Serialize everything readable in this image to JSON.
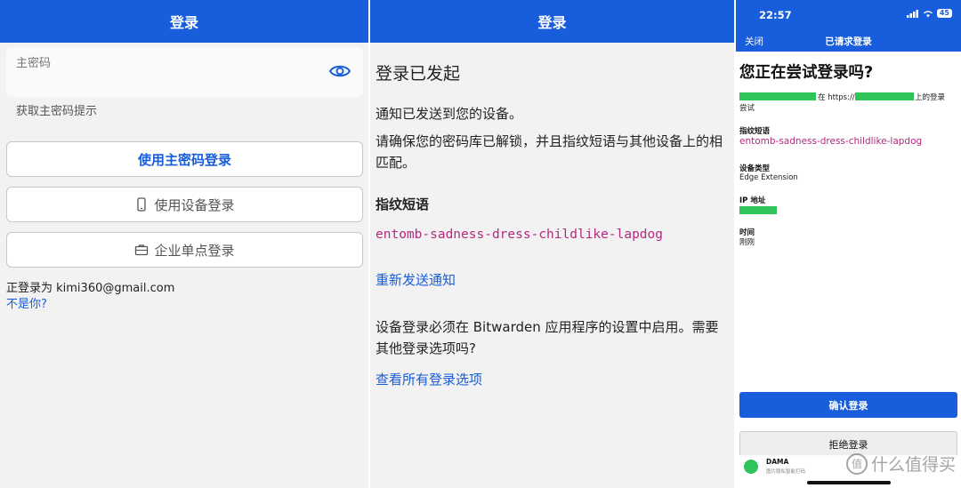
{
  "panel1": {
    "header_title": "登录",
    "master_password_label": "主密码",
    "get_hint_link": "获取主密码提示",
    "login_master_password_button": "使用主密码登录",
    "login_device_button": "使用设备登录",
    "enterprise_sso_button": "企业单点登录",
    "logged_in_as": "正登录为 kimi360@gmail.com",
    "not_you_link": "不是你?"
  },
  "panel2": {
    "header_title": "登录",
    "title": "登录已发起",
    "notification_sent": "通知已发送到您的设备。",
    "instructions": "请确保您的密码库已解锁，并且指纹短语与其他设备上的相匹配。",
    "fingerprint_heading": "指纹短语",
    "fingerprint_phrase": "entomb-sadness-dress-childlike-lapdog",
    "resend_link": "重新发送通知",
    "requirement_text": "设备登录必须在 Bitwarden 应用程序的设置中启用。需要其他登录选项吗?",
    "view_all_link": "查看所有登录选项"
  },
  "panel3": {
    "time": "22:57",
    "battery": "45",
    "close_link": "关闭",
    "nav_title": "已请求登录",
    "question_title": "您正在尝试登录吗?",
    "attempt_mid": "在 https://",
    "attempt_end": "上的登录",
    "attempt_line2": "尝试",
    "fingerprint_label": "指纹短语",
    "fingerprint_phrase": "entomb-sadness-dress-childlike-lapdog",
    "device_type_label": "设备类型",
    "device_type_value": "Edge Extension",
    "ip_label": "IP 地址",
    "time_label": "时间",
    "time_value": "刚刚",
    "confirm_button": "确认登录",
    "deny_button": "拒绝登录",
    "notification_name": "DAMA",
    "notification_sub": "图片隐私智能打码"
  },
  "watermark": {
    "text": "什么值得买",
    "badge": "值"
  },
  "colors": {
    "brand_blue": "#175ddc",
    "fingerprint_magenta": "#b5287e",
    "redaction_green": "#2fc45a"
  }
}
